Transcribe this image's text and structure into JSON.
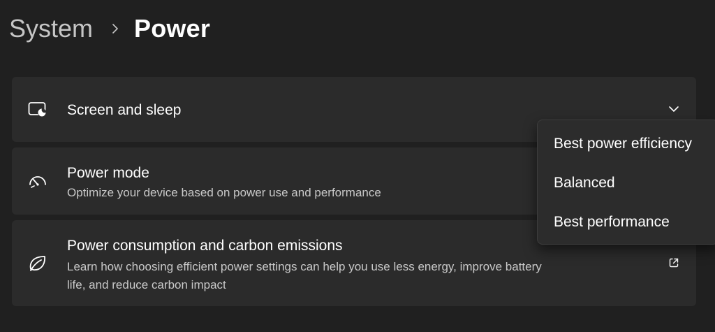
{
  "breadcrumb": {
    "parent": "System",
    "current": "Power"
  },
  "cards": {
    "screen_sleep": {
      "title": "Screen and sleep",
      "icon": "screen-sleep-icon"
    },
    "power_mode": {
      "title": "Power mode",
      "description": "Optimize your device based on power use and performance",
      "icon": "power-mode-gauge-icon"
    },
    "carbon": {
      "title": "Power consumption and carbon emissions",
      "description_line1": "Learn how choosing efficient power settings can help you use less energy, improve battery",
      "description_line2": "life, and reduce carbon impact",
      "icon": "leaf-icon"
    }
  },
  "power_mode_dropdown": {
    "options": [
      "Best power efficiency",
      "Balanced",
      "Best performance"
    ]
  },
  "colors": {
    "background": "#202020",
    "card": "#2b2b2b",
    "dropdown": "#2c2c2c",
    "text_primary": "#ffffff",
    "text_secondary": "#c9c9c9",
    "breadcrumb_parent": "#c6c6c6"
  }
}
